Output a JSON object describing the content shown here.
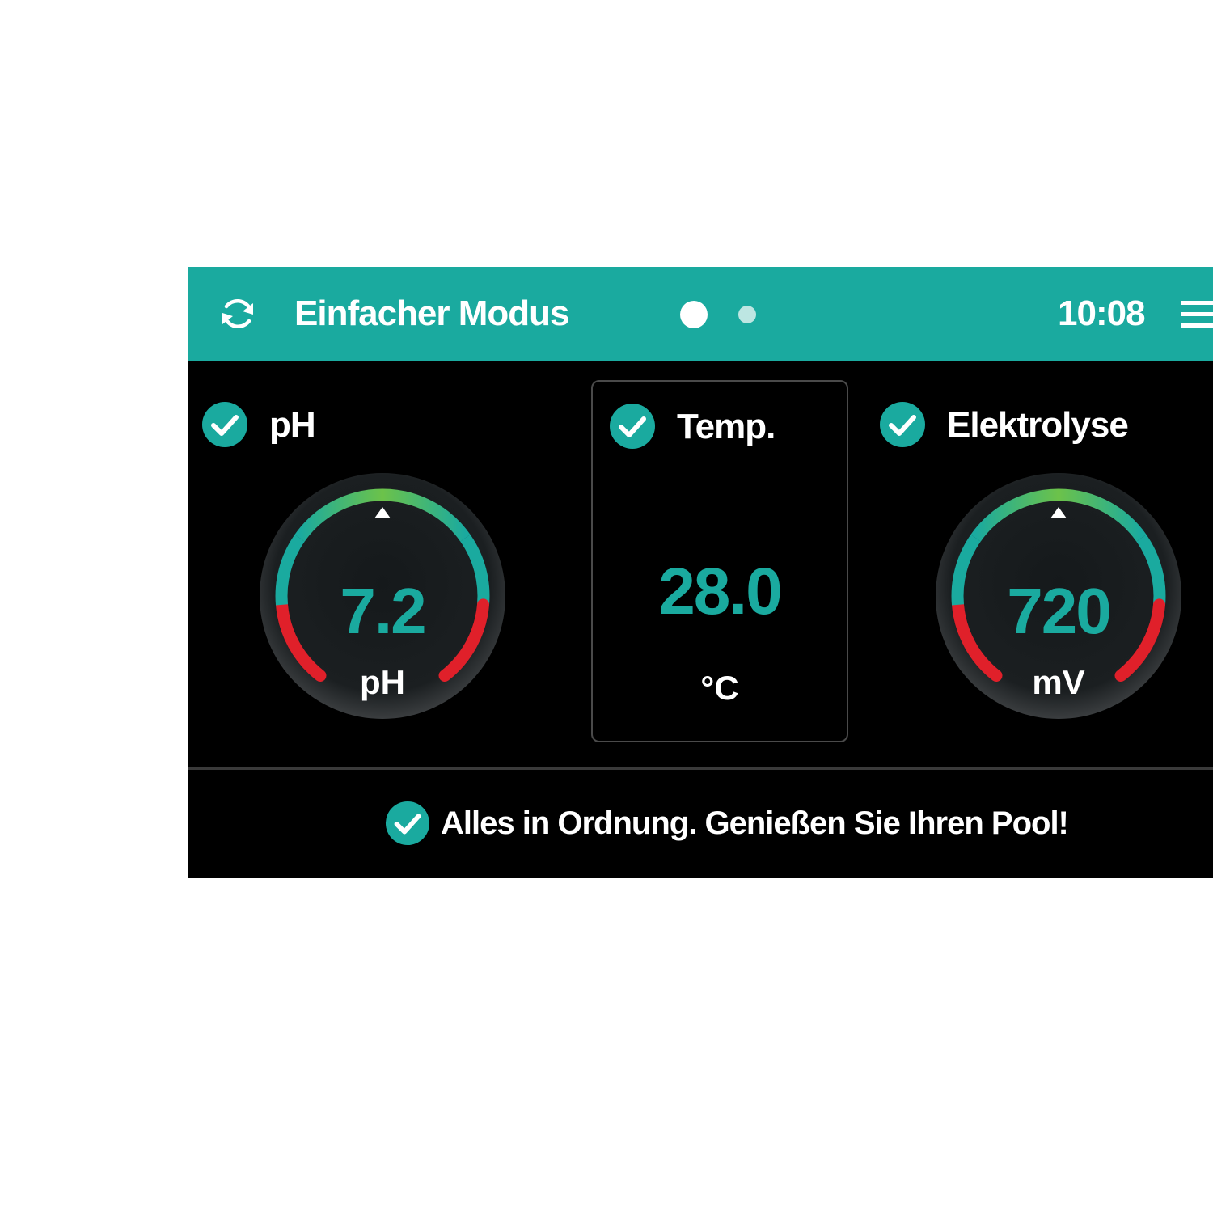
{
  "colors": {
    "accent": "#1aaa9f",
    "ok_green": "#6cc24a",
    "alarm_red": "#e0202a",
    "background": "#000000"
  },
  "header": {
    "refresh_icon": "refresh-icon",
    "title": "Einfacher Modus",
    "page_count": 2,
    "active_page": 1,
    "time": "10:08",
    "menu_icon": "hamburger-menu-icon"
  },
  "cards": {
    "ph": {
      "label": "pH",
      "status_icon": "check-circle-icon",
      "value": "7.2",
      "unit": "pH"
    },
    "temp": {
      "label": "Temp.",
      "status_icon": "check-circle-icon",
      "value": "28.0",
      "unit": "°C"
    },
    "elektrolyse": {
      "label": "Elektrolyse",
      "status_icon": "check-circle-icon",
      "value": "720",
      "unit": "mV"
    }
  },
  "status": {
    "icon": "check-circle-icon",
    "message": "Alles in Ordnung. Genießen Sie Ihren Pool!"
  }
}
